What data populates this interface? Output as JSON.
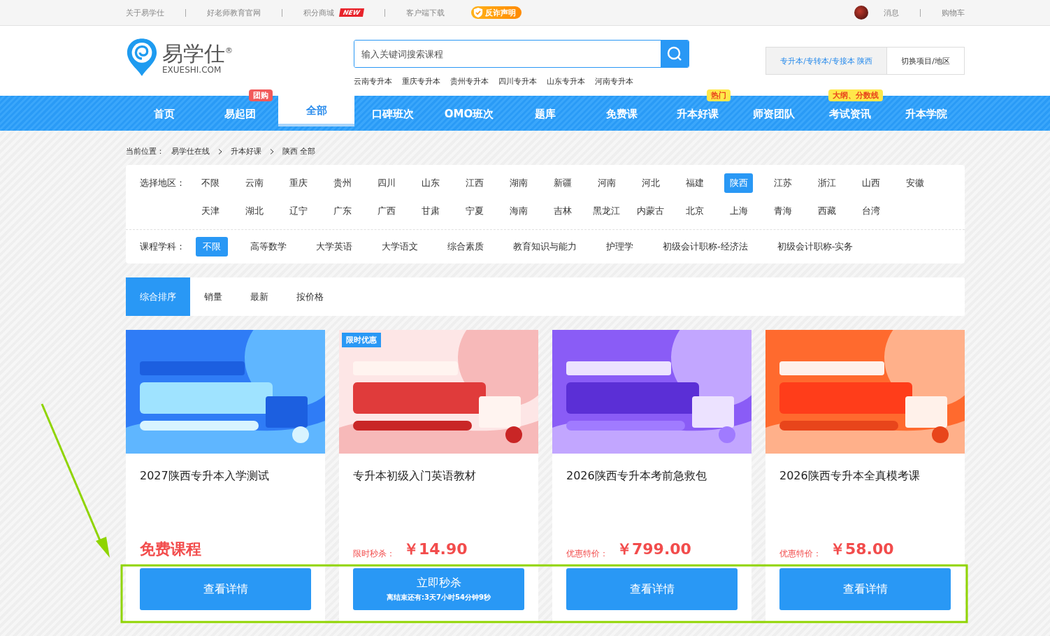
{
  "top_bar": {
    "links": [
      {
        "label": "关于易学仕",
        "kind": "plain"
      },
      {
        "label": "好老师教育官网",
        "kind": "plain"
      },
      {
        "label": "积分商城",
        "kind": "new",
        "badge": "NEW"
      },
      {
        "label": "客户端下载",
        "kind": "plain"
      }
    ],
    "notice": "反诈声明",
    "right_links": [
      "消息",
      "购物车"
    ]
  },
  "header": {
    "logo": {
      "name": "易学仕",
      "mark": "®",
      "domain": "EXUESHI.COM"
    },
    "search": {
      "placeholder": "输入关键词搜索课程"
    },
    "hot_searches": [
      "云南专升本",
      "重庆专升本",
      "贵州专升本",
      "四川专升本",
      "山东专升本",
      "河南专升本"
    ],
    "project": "专升本/专转本/专接本 陕西",
    "switch": "切换项目/地区"
  },
  "nav": [
    {
      "label": "首页",
      "selected": false
    },
    {
      "label": "易起团",
      "selected": false,
      "badge": "团购",
      "color": "#f25a5a"
    },
    {
      "label": "全部",
      "selected": true
    },
    {
      "label": "口碑班次",
      "selected": false
    },
    {
      "label": "OMO班次",
      "selected": false
    },
    {
      "label": "题库",
      "selected": false
    },
    {
      "label": "免费课",
      "selected": false
    },
    {
      "label": "升本好课",
      "selected": false,
      "badge": "热门",
      "color": "#ffe84a"
    },
    {
      "label": "师资团队",
      "selected": false
    },
    {
      "label": "考试资讯",
      "selected": false,
      "badge": "大纲、分数线",
      "color": "#ffe84a"
    },
    {
      "label": "升本学院",
      "selected": false
    }
  ],
  "breadcrumb": {
    "label": "当前位置：",
    "items": [
      "易学仕在线",
      "升本好课",
      "陕西 全部"
    ]
  },
  "filters": [
    {
      "label": "选择地区：",
      "options": [
        {
          "label": "不限",
          "selected": false
        },
        {
          "label": "云南",
          "selected": false
        },
        {
          "label": "重庆",
          "selected": false
        },
        {
          "label": "贵州",
          "selected": false
        },
        {
          "label": "四川",
          "selected": false
        },
        {
          "label": "山东",
          "selected": false
        },
        {
          "label": "江西",
          "selected": false
        },
        {
          "label": "湖南",
          "selected": false
        },
        {
          "label": "新疆",
          "selected": false
        },
        {
          "label": "河南",
          "selected": false
        },
        {
          "label": "河北",
          "selected": false
        },
        {
          "label": "福建",
          "selected": false
        },
        {
          "label": "陕西",
          "selected": true
        },
        {
          "label": "江苏",
          "selected": false
        },
        {
          "label": "浙江",
          "selected": false
        },
        {
          "label": "山西",
          "selected": false
        },
        {
          "label": "安徽",
          "selected": false
        },
        {
          "label": "天津",
          "selected": false
        },
        {
          "label": "湖北",
          "selected": false
        },
        {
          "label": "辽宁",
          "selected": false
        },
        {
          "label": "广东",
          "selected": false
        },
        {
          "label": "广西",
          "selected": false
        },
        {
          "label": "甘肃",
          "selected": false
        },
        {
          "label": "宁夏",
          "selected": false
        },
        {
          "label": "海南",
          "selected": false
        },
        {
          "label": "吉林",
          "selected": false
        },
        {
          "label": "黑龙江",
          "selected": false
        },
        {
          "label": "内蒙古",
          "selected": false
        },
        {
          "label": "北京",
          "selected": false
        },
        {
          "label": "上海",
          "selected": false
        },
        {
          "label": "青海",
          "selected": false
        },
        {
          "label": "西藏",
          "selected": false
        },
        {
          "label": "台湾",
          "selected": false
        }
      ]
    },
    {
      "label": "课程学科：",
      "options": [
        {
          "label": "不限",
          "selected": true
        },
        {
          "label": "高等数学",
          "selected": false
        },
        {
          "label": "大学英语",
          "selected": false
        },
        {
          "label": "大学语文",
          "selected": false
        },
        {
          "label": "综合素质",
          "selected": false
        },
        {
          "label": "教育知识与能力",
          "selected": false
        },
        {
          "label": "护理学",
          "selected": false
        },
        {
          "label": "初级会计职称-经济法",
          "selected": false
        },
        {
          "label": "初级会计职称-实务",
          "selected": false
        }
      ]
    }
  ],
  "sort": [
    {
      "label": "综合排序",
      "selected": true
    },
    {
      "label": "销量",
      "selected": false
    },
    {
      "label": "最新",
      "selected": false
    },
    {
      "label": "按价格",
      "selected": false
    }
  ],
  "courses": [
    {
      "title": "2027陕西专升本入学测试",
      "price": "免费课程",
      "button": "查看详情"
    },
    {
      "badge": "限时优惠",
      "title": "专升本初级入门英语教材",
      "price_label": "限时秒杀：",
      "price": "￥14.90",
      "button": "立即秒杀",
      "button_note": "离结束还有:3天7小时54分钟9秒"
    },
    {
      "title": "2026陕西专升本考前急救包",
      "price_label": "优惠特价：",
      "price": "￥799.00",
      "button": "查看详情"
    },
    {
      "title": "2026陕西专升本全真模考课",
      "price_label": "优惠特价：",
      "price": "￥58.00",
      "button": "查看详情"
    }
  ]
}
